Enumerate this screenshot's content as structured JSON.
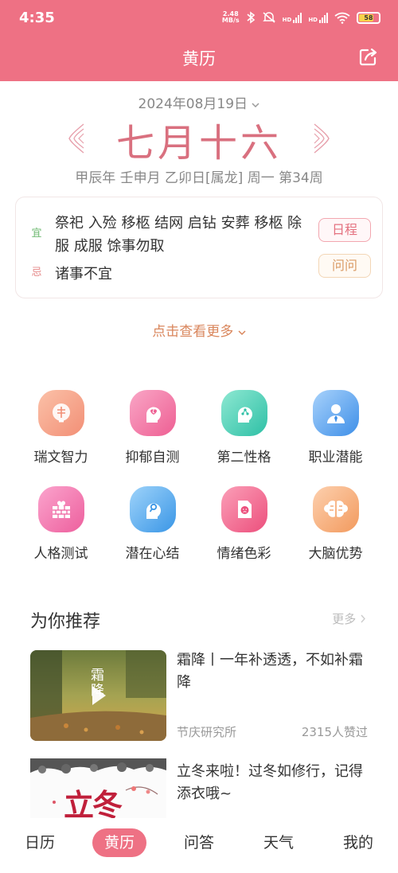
{
  "status_bar": {
    "time": "4:35",
    "net_speed_value": "2.48",
    "net_speed_unit": "MB/s",
    "sim1": "HD",
    "sim2": "HD",
    "battery": "58"
  },
  "header": {
    "title": "黄历",
    "share_icon": "share-icon",
    "bg_color": "#ee7184"
  },
  "calendar": {
    "date": "2024年08月19日",
    "lunar_day": "七月十六",
    "ganzhi": "甲辰年 壬申月 乙卯日[属龙] 周一 第34周"
  },
  "almanac": {
    "yi_label": "宜",
    "yi_text": "祭祀 入殓 移柩 结网 启钻 安葬 移柩 除服 成服 馀事勿取",
    "ji_label": "忌",
    "ji_text": "诸事不宜",
    "schedule_button": "日程",
    "ask_button": "问问"
  },
  "more_link": "点击查看更多",
  "features": [
    {
      "label": "瑞文智力",
      "icon": "brain-icon",
      "color": "#f49b7e"
    },
    {
      "label": "抑郁自测",
      "icon": "broken-heart-head-icon",
      "color": "#f26fa0"
    },
    {
      "label": "第二性格",
      "icon": "personality-head-icon",
      "color": "#3fcfb6"
    },
    {
      "label": "职业潜能",
      "icon": "business-person-icon",
      "color": "#4a9ef0"
    },
    {
      "label": "人格测试",
      "icon": "heart-wall-icon",
      "color": "#f06aa6"
    },
    {
      "label": "潜在心结",
      "icon": "search-head-icon",
      "color": "#3fa6ee"
    },
    {
      "label": "情绪色彩",
      "icon": "sad-document-icon",
      "color": "#f1658b"
    },
    {
      "label": "大脑优势",
      "icon": "brain-hemisphere-icon",
      "color": "#f5a066"
    }
  ],
  "recommend": {
    "title": "为你推荐",
    "more": "更多",
    "items": [
      {
        "title": "霜降丨一年补透透，不如补霜降",
        "source": "节庆研究所",
        "likes": "2315人赞过",
        "thumb_text": "霜降"
      },
      {
        "title": "立冬来啦！过冬如修行，记得添衣哦~",
        "thumb_text": "立冬"
      }
    ]
  },
  "tabs": [
    {
      "label": "日历",
      "active": false
    },
    {
      "label": "黄历",
      "active": true
    },
    {
      "label": "问答",
      "active": false
    },
    {
      "label": "天气",
      "active": false
    },
    {
      "label": "我的",
      "active": false
    }
  ]
}
